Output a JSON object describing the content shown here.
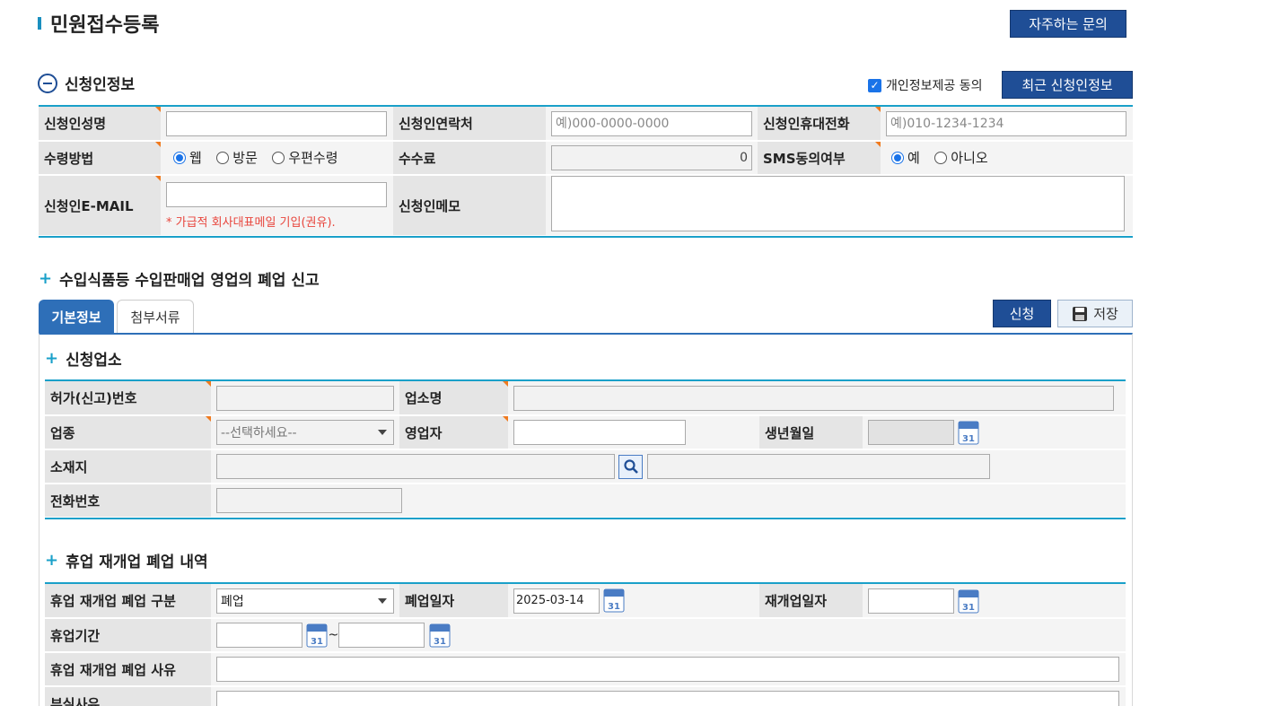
{
  "page": {
    "title": "민원접수등록",
    "faq_button": "자주하는 문의"
  },
  "applicant": {
    "section_title": "신청인정보",
    "consent_label": "개인정보제공 동의",
    "recent_button": "최근 신청인정보",
    "name_label": "신청인성명",
    "contact_label": "신청인연락처",
    "contact_placeholder": "예)000-0000-0000",
    "mobile_label": "신청인휴대전화",
    "mobile_placeholder": "예)010-1234-1234",
    "receive_label": "수령방법",
    "receive_options": [
      "웹",
      "방문",
      "우편수령"
    ],
    "fee_label": "수수료",
    "fee_value": "0",
    "sms_label": "SMS동의여부",
    "sms_options": [
      "예",
      "아니오"
    ],
    "email_label": "신청인E-MAIL",
    "email_note": "* 가급적 회사대표메일 기입(권유).",
    "memo_label": "신청인메모"
  },
  "report": {
    "title": "수입식품등 수입판매업 영업의 폐업 신고",
    "tabs": [
      "기본정보",
      "첨부서류"
    ],
    "apply_button": "신청",
    "save_button": "저장"
  },
  "business": {
    "section_title": "신청업소",
    "license_label": "허가(신고)번호",
    "name_label": "업소명",
    "type_label": "업종",
    "type_value": "--선택하세요--",
    "operator_label": "영업자",
    "birth_label": "생년월일",
    "address_label": "소재지",
    "phone_label": "전화번호"
  },
  "closure": {
    "section_title": "휴업 재개업 폐업 내역",
    "kind_label": "휴업 재개업 폐업 구분",
    "kind_value": "폐업",
    "close_date_label": "폐업일자",
    "close_date_value": "2025-03-14",
    "reopen_date_label": "재개업일자",
    "period_label": "휴업기간",
    "period_sep": "~",
    "reason_label": "휴업 재개업 폐업 사유",
    "extra_label": "부실사유"
  },
  "calendar_icon_text": "31",
  "colors": {
    "navy": "#1f4e96",
    "teal": "#1aa0c9",
    "required": "#f07a1e",
    "note_red": "#e8453c"
  }
}
